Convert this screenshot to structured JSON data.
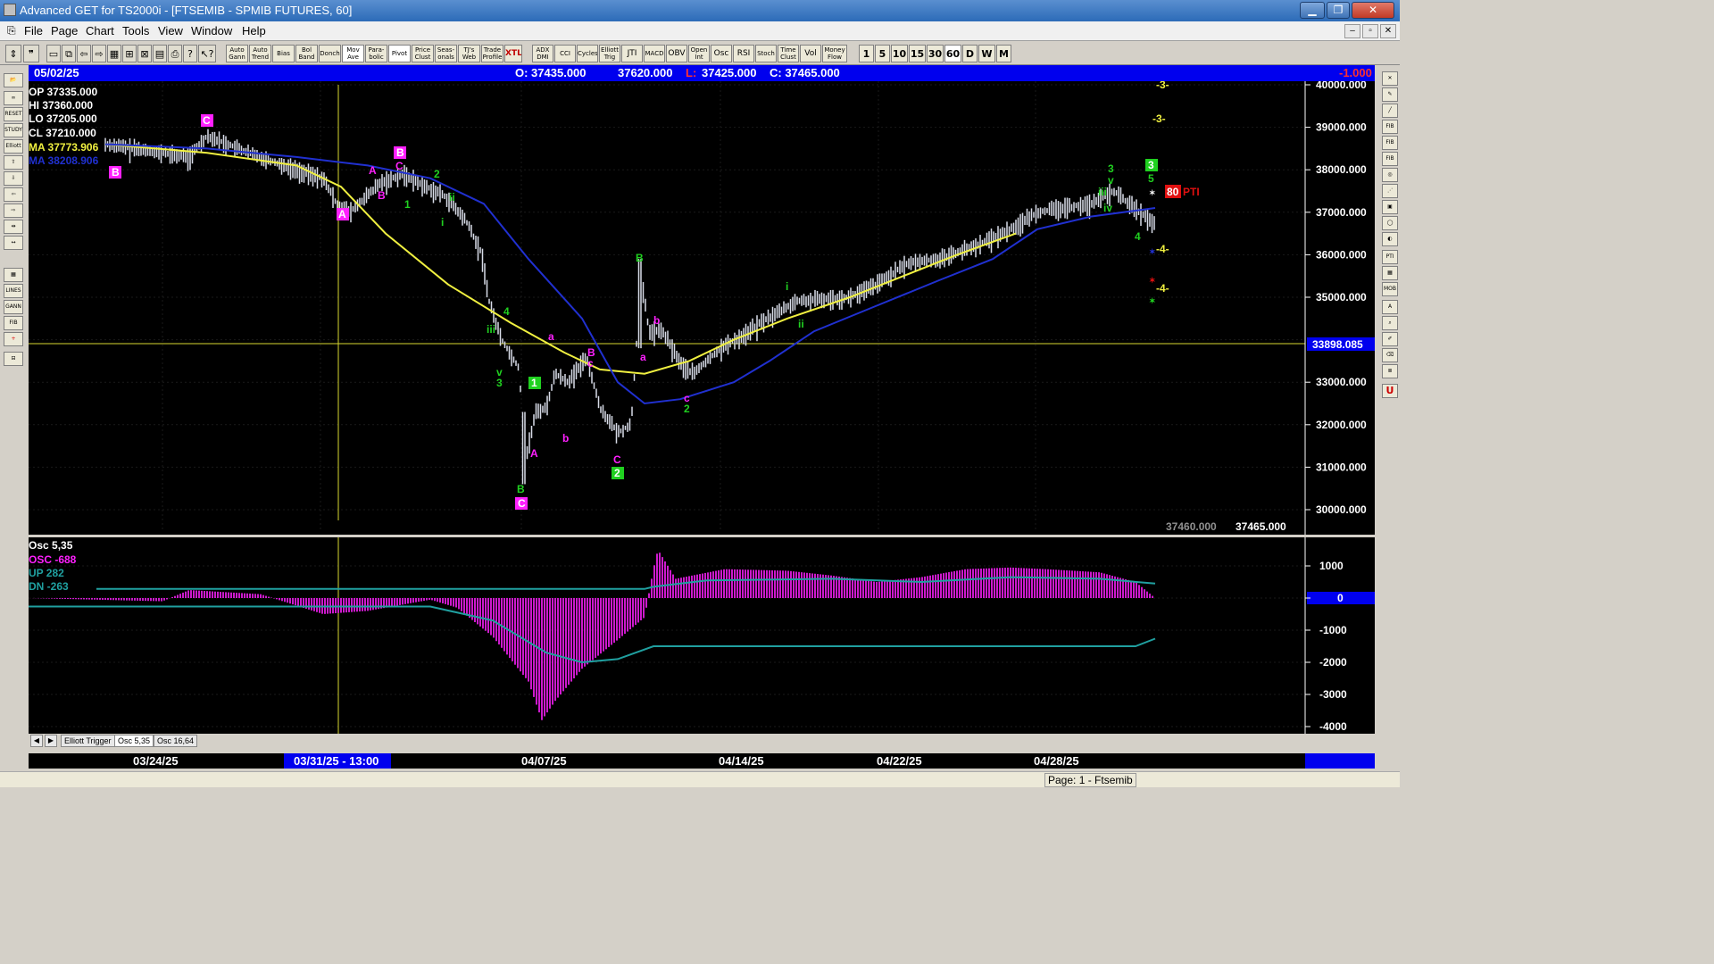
{
  "window": {
    "title": "Advanced GET for TS2000i - [FTSEMIB - SPMIB FUTURES, 60]",
    "buttons": [
      "▁",
      "❐",
      "✕"
    ]
  },
  "menu": {
    "items": [
      "File",
      "Page",
      "Chart",
      "Tools",
      "View",
      "Window",
      "Help"
    ],
    "mdi_buttons": [
      "–",
      "▫",
      "✕"
    ]
  },
  "toolbar": {
    "study_buttons": [
      "Auto Gann",
      "Auto Trend",
      "Bias",
      "Bol Band",
      "Donch",
      "Mov Ave",
      "Para-bolic",
      "Pivot",
      "Price Clust",
      "Seas-onals",
      "TJ's Web",
      "Trade Profile",
      "XTL",
      "ADX DMI",
      "CCI",
      "Cycles",
      "Elliott Trig",
      "JTI",
      "MACD",
      "OBV",
      "Open Int",
      "Osc",
      "RSI",
      "Stoch",
      "Time Clust",
      "Vol",
      "Money Flow"
    ],
    "interval_buttons": [
      "1",
      "5",
      "10",
      "15",
      "30",
      "60",
      "D",
      "W",
      "M"
    ]
  },
  "info_bar": {
    "date": "05/02/25",
    "open": "O: 37435.000",
    "high": "37620.000",
    "low_label": "L:",
    "low": "37425.000",
    "close": "C: 37465.000",
    "change": "-1.000"
  },
  "data_window": {
    "op": "OP  37335.000",
    "hi": "HI   37360.000",
    "lo": "LO  37205.000",
    "cl": "CL  37210.000",
    "ma1": "MA  37773.906",
    "ma2": "MA  38208.906"
  },
  "price_axis": {
    "labels": [
      "40000.000",
      "39000.000",
      "38000.000",
      "37000.000",
      "36000.000",
      "35000.000",
      "33000.000",
      "32000.000",
      "31000.000",
      "30000.000"
    ],
    "cursor_price": "33898.085",
    "bottom_left_value": "37460.000",
    "bottom_right_value": "37465.000"
  },
  "waves": {
    "wave_labels_magenta": [
      "C",
      "B",
      "C",
      "A",
      "B",
      "A",
      "a",
      "b",
      "B",
      "c",
      "A",
      "b",
      "C",
      "a",
      "b",
      "c",
      "C",
      "B"
    ],
    "wave_labels_green": [
      "2",
      "1",
      "ii",
      "i",
      "4",
      "iii",
      "v",
      "3",
      "1",
      "2",
      "B",
      "B",
      "i",
      "ii",
      "3",
      "v",
      "iii",
      "iv",
      "3",
      "5",
      "4"
    ],
    "projection_labels": [
      "-3-",
      "-3-",
      "-4-",
      "-4-"
    ],
    "pti_value": "80",
    "pti_label": "PTI"
  },
  "oscillator": {
    "title": "Osc 5,35",
    "osc": "OSC -688",
    "up": "UP   282",
    "dn": "DN   -263",
    "axis_labels": [
      "1000",
      "0",
      "-1000",
      "-2000",
      "-3000",
      "-4000"
    ]
  },
  "tabs": [
    "Elliott Trigger",
    "Osc 5,35",
    "Osc 16,64"
  ],
  "date_axis": {
    "labels": [
      "03/24/25",
      "03/31/25 - 13:00",
      "04/07/25",
      "04/14/25",
      "04/22/25",
      "04/28/25"
    ]
  },
  "status": {
    "page": "Page: 1 - Ftsemib"
  },
  "colors": {
    "info_bar": "#0000ee",
    "ma_fast": "#f0f040",
    "ma_slow": "#2030d0",
    "osc_hist": "#ff20ff",
    "osc_bands": "#20a0a0",
    "wave_magenta": "#ff20ff",
    "wave_green": "#20d020"
  }
}
